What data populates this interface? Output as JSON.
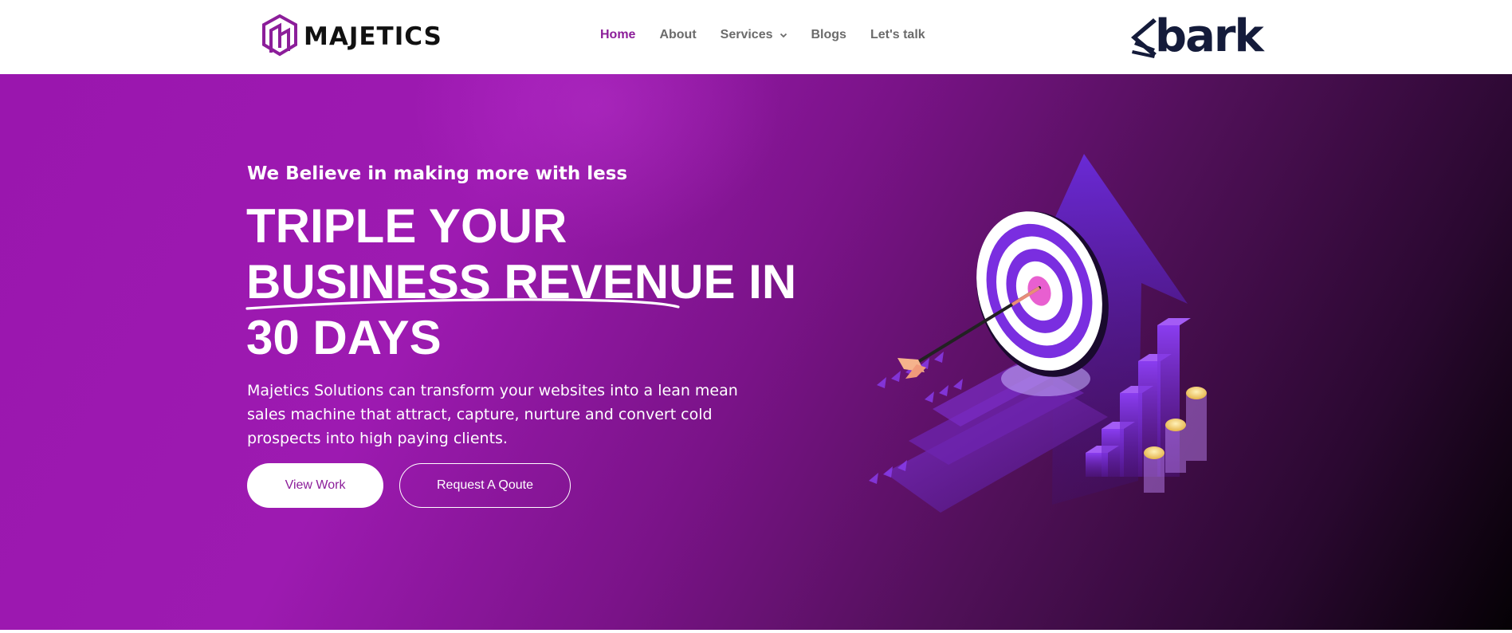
{
  "header": {
    "logo": {
      "name": "MAJETICS",
      "icon": "majetics-logo-icon"
    },
    "nav": [
      {
        "label": "Home",
        "active": true
      },
      {
        "label": "About",
        "active": false
      },
      {
        "label": "Services",
        "active": false,
        "icon": "chevron-down-icon"
      },
      {
        "label": "Blogs",
        "active": false
      },
      {
        "label": "Let's talk",
        "active": false
      }
    ],
    "partner_logo": {
      "name": "bark",
      "icon": "bark-logo-icon"
    }
  },
  "hero": {
    "tagline": "We Believe in making more with less",
    "headline": {
      "line1": "TRIPLE YOUR",
      "line2_highlight": "BUSINESS REVENUE",
      "line2_rest": " IN",
      "line3": "30 DAYS"
    },
    "description": "Majetics Solutions can transform your websites into a lean mean sales machine that attract, capture, nurture and convert cold prospects into high paying clients.",
    "buttons": {
      "primary": "View Work",
      "secondary": "Request A Qoute"
    },
    "illustration": "target-growth-illustration"
  },
  "colors": {
    "accent": "#8c1e9a",
    "nav_text": "#6b6b6b",
    "hero_gradient_start": "#9a16ae",
    "hero_gradient_end": "#050105",
    "partner_logo": "#141b3a"
  }
}
